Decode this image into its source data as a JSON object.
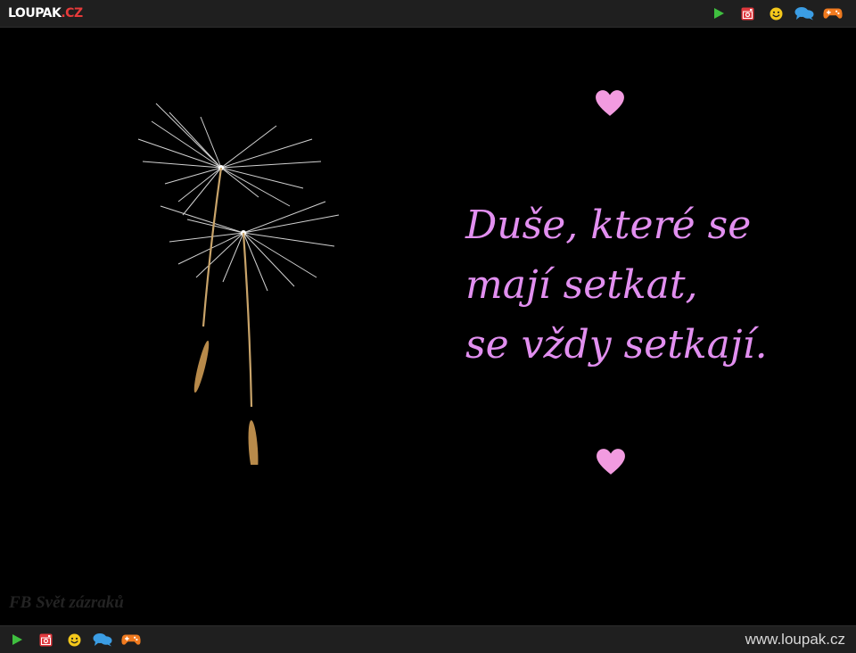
{
  "header": {
    "logo_main": "LOUPAK",
    "logo_suffix": ".CZ",
    "icons": [
      "play-icon",
      "instagram-icon",
      "smiley-icon",
      "chat-icon",
      "gamepad-icon"
    ]
  },
  "content": {
    "quote_lines": [
      "Duše, které se",
      "mají setkat,",
      "se vždy setkají."
    ],
    "credit": "FB Svět zázraků",
    "colors": {
      "quote": "#e28ff0",
      "heart": "#f29be0",
      "background": "#000000"
    }
  },
  "footer": {
    "icons": [
      "play-icon",
      "instagram-icon",
      "smiley-icon",
      "chat-icon",
      "gamepad-icon"
    ],
    "url": "www.loupak.cz"
  }
}
